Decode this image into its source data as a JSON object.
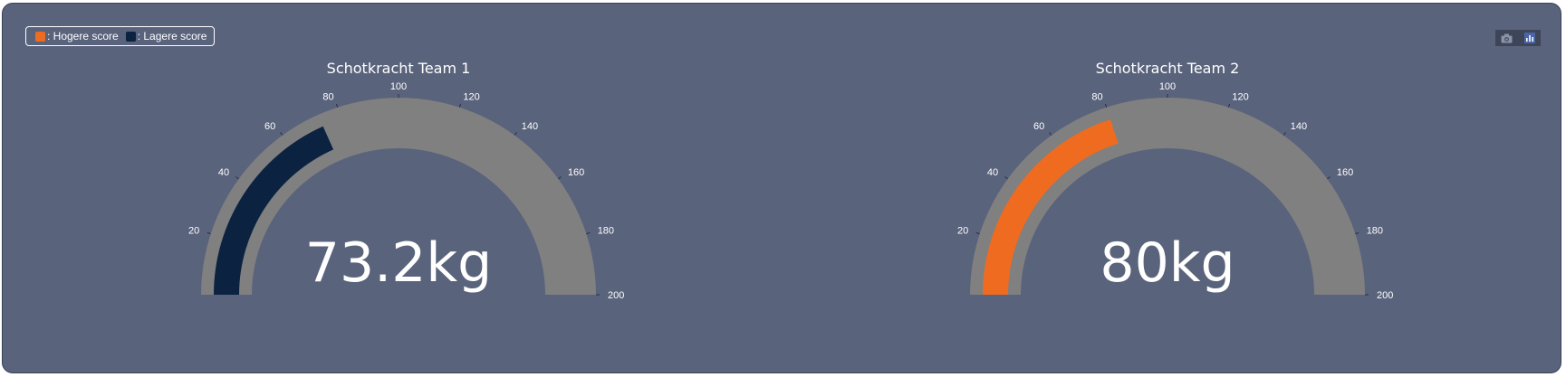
{
  "legend": {
    "items": [
      {
        "label": ": Hogere score",
        "color": "#ef6b1f"
      },
      {
        "label": ": Lagere score",
        "color": "#0b2240"
      }
    ]
  },
  "modebar": {
    "icons": [
      "camera-icon",
      "plotly-logo-icon"
    ]
  },
  "colors": {
    "panel_bg": "#59637c",
    "gauge_track": "#808080",
    "higher": "#ef6b1f",
    "lower": "#0b2240"
  },
  "chart_data": [
    {
      "type": "gauge",
      "title": "Schotkracht Team 1",
      "value": 73.2,
      "value_text": "73.2kg",
      "range": [
        0,
        200
      ],
      "tick_values": [
        20,
        40,
        60,
        80,
        100,
        120,
        140,
        160,
        180,
        200
      ],
      "tick_labels": [
        "20",
        "40",
        "60",
        "80",
        "100",
        "120",
        "140",
        "160",
        "180",
        "200"
      ],
      "bar_color": "#0b2240",
      "series": "Lagere score"
    },
    {
      "type": "gauge",
      "title": "Schotkracht Team 2",
      "value": 80,
      "value_text": "80kg",
      "range": [
        0,
        200
      ],
      "tick_values": [
        20,
        40,
        60,
        80,
        100,
        120,
        140,
        160,
        180,
        200
      ],
      "tick_labels": [
        "20",
        "40",
        "60",
        "80",
        "100",
        "120",
        "140",
        "160",
        "180",
        "200"
      ],
      "bar_color": "#ef6b1f",
      "series": "Hogere score"
    }
  ]
}
